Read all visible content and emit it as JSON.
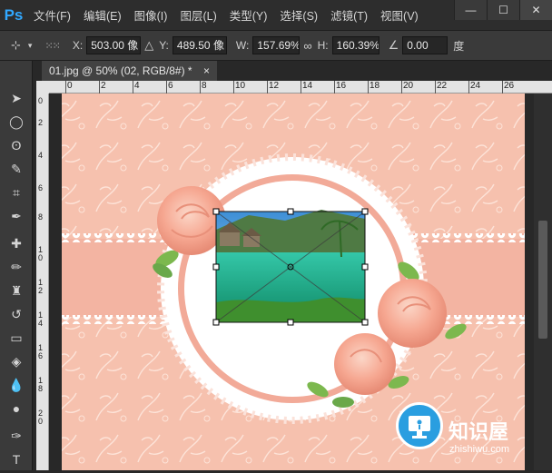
{
  "app": {
    "logo": "Ps"
  },
  "menu": [
    "文件(F)",
    "编辑(E)",
    "图像(I)",
    "图层(L)",
    "类型(Y)",
    "选择(S)",
    "滤镜(T)",
    "视图(V)"
  ],
  "window_controls": {
    "minimize": "—",
    "maximize": "☐",
    "close": "✕"
  },
  "options": {
    "x_label": "X:",
    "x_value": "503.00 像",
    "y_label": "Y:",
    "y_value": "489.50 像",
    "w_label": "W:",
    "w_value": "157.69%",
    "h_label": "H:",
    "h_value": "160.39%",
    "angle_value": "0.00",
    "angle_unit": "度"
  },
  "document_tab": {
    "title": "01.jpg @ 50% (02, RGB/8#) *",
    "close": "×"
  },
  "ruler_h": [
    "0",
    "2",
    "4",
    "6",
    "8",
    "10",
    "12",
    "14",
    "16",
    "18",
    "20",
    "22",
    "24",
    "26"
  ],
  "ruler_v": [
    "0",
    "2",
    "4",
    "6",
    "8",
    "10",
    "12",
    "14",
    "16",
    "18",
    "20"
  ],
  "watermark": {
    "name": "知识屋",
    "url": "zhishiwu.com"
  },
  "colors": {
    "pink_bg": "#f6c0ae",
    "pink_band": "#f3b4a2",
    "frame_ring": "#f2aa98",
    "accent_blue": "#31a8ff"
  }
}
